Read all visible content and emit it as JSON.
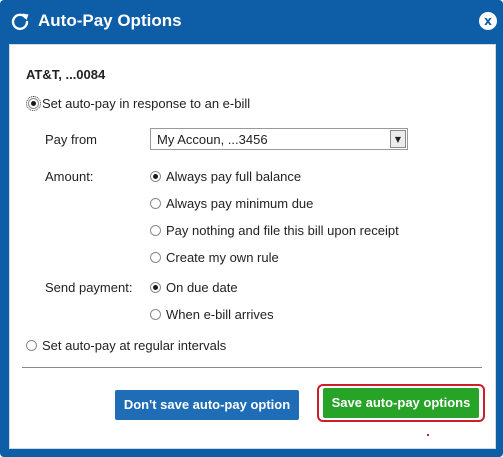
{
  "dialog": {
    "title": "Auto-Pay Options",
    "close_label": "x",
    "icons": {
      "title": "refresh-icon",
      "close": "close-icon"
    },
    "colors": {
      "header": "#0d5ea6",
      "primary_button": "#27a327",
      "secondary_button": "#1f6db7",
      "highlight": "#cc1f2d"
    }
  },
  "biller": "AT&T, ...0084",
  "mode": {
    "ebill_label": "Set auto-pay in response to an e-bill",
    "ebill_selected": true,
    "intervals_label": "Set auto-pay at regular intervals",
    "intervals_selected": false
  },
  "pay_from": {
    "label": "Pay from",
    "selected": "My Accoun, ...3456"
  },
  "amount": {
    "label": "Amount:",
    "options": [
      {
        "label": "Always pay full balance",
        "selected": true
      },
      {
        "label": "Always pay minimum due",
        "selected": false
      },
      {
        "label": "Pay nothing and file this bill upon receipt",
        "selected": false
      },
      {
        "label": "Create my own rule",
        "selected": false
      }
    ]
  },
  "send_payment": {
    "label": "Send payment:",
    "options": [
      {
        "label": "On due date",
        "selected": true
      },
      {
        "label": "When e-bill arrives",
        "selected": false
      }
    ]
  },
  "buttons": {
    "dont_save": "Don't save auto-pay option",
    "save": "Save auto-pay options"
  }
}
